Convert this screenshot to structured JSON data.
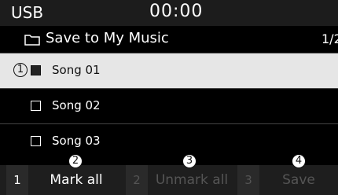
{
  "status_bar": {
    "source": "USB",
    "time": "00:00"
  },
  "header": {
    "title": "Save to My Music",
    "page": "1/2"
  },
  "songs": [
    {
      "label": "Song 01",
      "checked": true,
      "selected": true
    },
    {
      "label": "Song 02",
      "checked": false,
      "selected": false
    },
    {
      "label": "Song 03",
      "checked": false,
      "selected": false
    }
  ],
  "softkeys": [
    {
      "num": "1",
      "label": "Mark all",
      "enabled": true
    },
    {
      "num": "2",
      "label": "Unmark all",
      "enabled": false
    },
    {
      "num": "3",
      "label": "Save",
      "enabled": false
    }
  ],
  "callouts": {
    "c1": "1",
    "c2": "2",
    "c3": "3",
    "c4": "4"
  },
  "icons": {
    "folder": "folder-icon",
    "checkbox": "checkbox-icon"
  },
  "colors": {
    "selected_row": "#e6e6e6",
    "background": "#000000",
    "disabled_text": "#555555"
  }
}
